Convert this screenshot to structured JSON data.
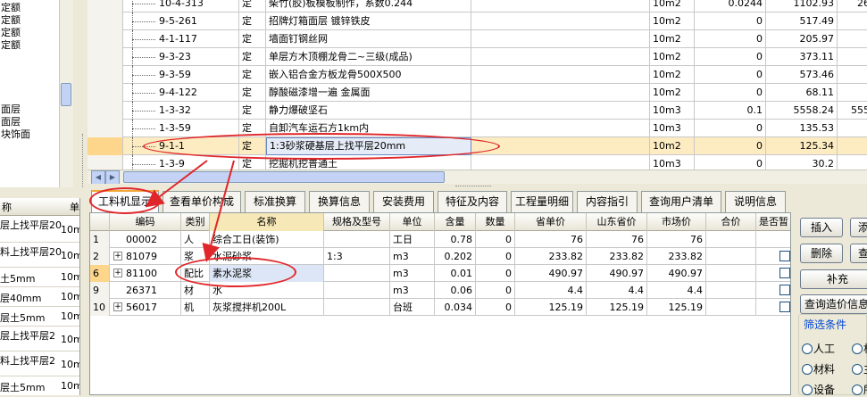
{
  "left_tree": {
    "items": [
      "定额",
      "定额",
      "定额",
      "定额",
      "",
      "",
      "",
      "",
      "面层",
      "面层",
      "块饰面"
    ]
  },
  "left_list": {
    "headers": [
      "称",
      "单"
    ],
    "rows": [
      {
        "name": "层上找平层20",
        "unit": "10m"
      },
      {
        "name": "料上找平层20",
        "unit": "10m"
      },
      {
        "name": "土5mm",
        "unit": "10m"
      },
      {
        "name": "层40mm",
        "unit": "10m"
      },
      {
        "name": "层土5mm",
        "unit": "10m"
      },
      {
        "name": "层上找平层2",
        "unit": "10m"
      },
      {
        "name": "料上找平层2",
        "unit": "10m"
      },
      {
        "name": "层土5mm",
        "unit": "10m"
      }
    ]
  },
  "upper_grid": {
    "rows": [
      {
        "code": "10-4-313",
        "type": "定",
        "name": "柴竹(胶)板模板制作，系数0.244",
        "unit": "10m2",
        "qty": "0.0244",
        "price": "1102.93",
        "extra": "26"
      },
      {
        "code": "9-5-261",
        "type": "定",
        "name": "招牌灯箱面层 镀锌铁皮",
        "unit": "10m2",
        "qty": "0",
        "price": "517.49",
        "extra": ""
      },
      {
        "code": "4-1-117",
        "type": "定",
        "name": "墙面钉钢丝网",
        "unit": "10m2",
        "qty": "0",
        "price": "205.97",
        "extra": ""
      },
      {
        "code": "9-3-23",
        "type": "定",
        "name": "单层方木顶棚龙骨二~三级(成品)",
        "unit": "10m2",
        "qty": "0",
        "price": "373.11",
        "extra": ""
      },
      {
        "code": "9-3-59",
        "type": "定",
        "name": "嵌入铝合金方板龙骨500X500",
        "unit": "10m2",
        "qty": "0",
        "price": "573.46",
        "extra": ""
      },
      {
        "code": "9-4-122",
        "type": "定",
        "name": "醇酸磁漆增一遍 金属面",
        "unit": "10m2",
        "qty": "0",
        "price": "68.11",
        "extra": ""
      },
      {
        "code": "1-3-32",
        "type": "定",
        "name": "静力爆破坚石",
        "unit": "10m3",
        "qty": "0.1",
        "price": "5558.24",
        "extra": "555"
      },
      {
        "code": "1-3-59",
        "type": "定",
        "name": "自卸汽车运石方1km内",
        "unit": "10m3",
        "qty": "0",
        "price": "135.53",
        "extra": ""
      },
      {
        "code": "9-1-1",
        "type": "定",
        "name": "1:3砂浆硬基层上找平层20mm",
        "unit": "10m2",
        "qty": "0",
        "price": "125.34",
        "extra": ""
      },
      {
        "code": "1-3-9",
        "type": "定",
        "name": "挖掘机挖普通土",
        "unit": "10m3",
        "qty": "0",
        "price": "30.2",
        "extra": ""
      }
    ]
  },
  "tabs": [
    "工料机显示",
    "查看单价构成",
    "标准换算",
    "换算信息",
    "安装费用",
    "特征及内容",
    "工程量明细",
    "内容指引",
    "查询用户清单",
    "说明信息"
  ],
  "lower_grid": {
    "headers": [
      "",
      "编码",
      "类别",
      "名称",
      "规格及型号",
      "单位",
      "含量",
      "数量",
      "省单价",
      "山东省价",
      "市场价",
      "合价",
      "是否暂"
    ],
    "rows": [
      {
        "idx": "1",
        "code": "00002",
        "cat": "人",
        "name": "综合工日(装饰)",
        "spec": "",
        "unit": "工日",
        "content": "0.78",
        "qty": "0",
        "prov": "76",
        "sd": "76",
        "market": "76",
        "total": "",
        "plus": false
      },
      {
        "idx": "2",
        "code": "81079",
        "cat": "浆",
        "name": "水泥砂浆",
        "spec": "1:3",
        "unit": "m3",
        "content": "0.202",
        "qty": "0",
        "prov": "233.82",
        "sd": "233.82",
        "market": "233.82",
        "total": "",
        "plus": true
      },
      {
        "idx": "6",
        "code": "81100",
        "cat": "配比",
        "name": "素水泥浆",
        "spec": "",
        "unit": "m3",
        "content": "0.01",
        "qty": "0",
        "prov": "490.97",
        "sd": "490.97",
        "market": "490.97",
        "total": "",
        "plus": true
      },
      {
        "idx": "9",
        "code": "26371",
        "cat": "材",
        "name": "水",
        "spec": "",
        "unit": "m3",
        "content": "0.06",
        "qty": "0",
        "prov": "4.4",
        "sd": "4.4",
        "market": "4.4",
        "total": "",
        "plus": false
      },
      {
        "idx": "10",
        "code": "56017",
        "cat": "机",
        "name": "灰浆搅拌机200L",
        "spec": "",
        "unit": "台班",
        "content": "0.034",
        "qty": "0",
        "prov": "125.19",
        "sd": "125.19",
        "market": "125.19",
        "total": "",
        "plus": true
      }
    ]
  },
  "right_panel": {
    "insert": "插入",
    "add": "添",
    "delete": "删除",
    "query": "查",
    "supplement": "补充",
    "price_query": "查询造价信息",
    "filter_title": "筛选条件",
    "filters": [
      "人工",
      "机",
      "材料",
      "主",
      "设备",
      "所"
    ]
  },
  "colors": {
    "annotation": "#e0262a",
    "selected_row": "#fdecc1",
    "active_tab_accent": "#f0a83a"
  }
}
